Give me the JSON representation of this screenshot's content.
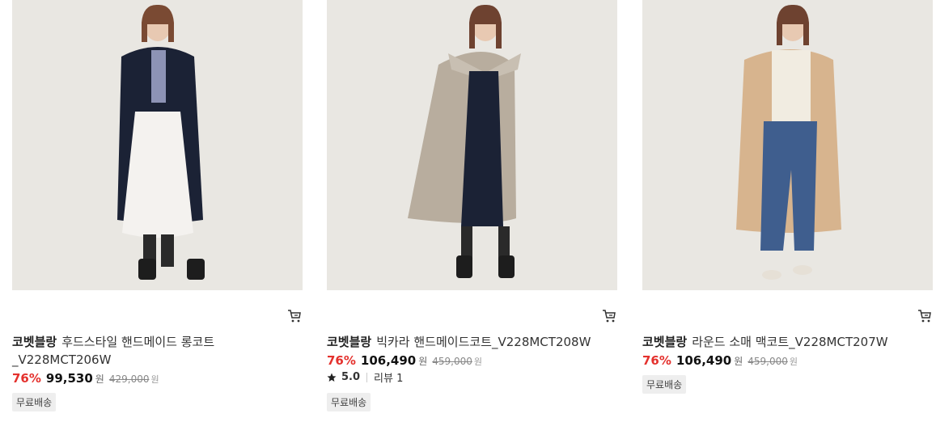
{
  "products": [
    {
      "brand": "코벳블랑",
      "name": "후드스타일 핸드메이드 롱코트",
      "name_line2": "_V228MCT206W",
      "discount": "76%",
      "sale_price": "99,530",
      "currency": "원",
      "original_price": "429,000",
      "shipping": "무료배송",
      "image_alt": "navy hooded long coat model photo",
      "coat_color": "#1b2235"
    },
    {
      "brand": "코벳블랑",
      "name": "빅카라 핸드메이드코트_V228MCT208W",
      "discount": "76%",
      "sale_price": "106,490",
      "currency": "원",
      "original_price": "459,000",
      "rating": "5.0",
      "review_label": "리뷰 1",
      "shipping": "무료배송",
      "image_alt": "oatmeal big collar coat model photo",
      "coat_color": "#b8ad9e"
    },
    {
      "brand": "코벳블랑",
      "name": "라운드 소매 맥코트_V228MCT207W",
      "discount": "76%",
      "sale_price": "106,490",
      "currency": "원",
      "original_price": "459,000",
      "shipping": "무료배송",
      "image_alt": "camel mac coat model photo",
      "coat_color": "#d7b48e"
    }
  ]
}
